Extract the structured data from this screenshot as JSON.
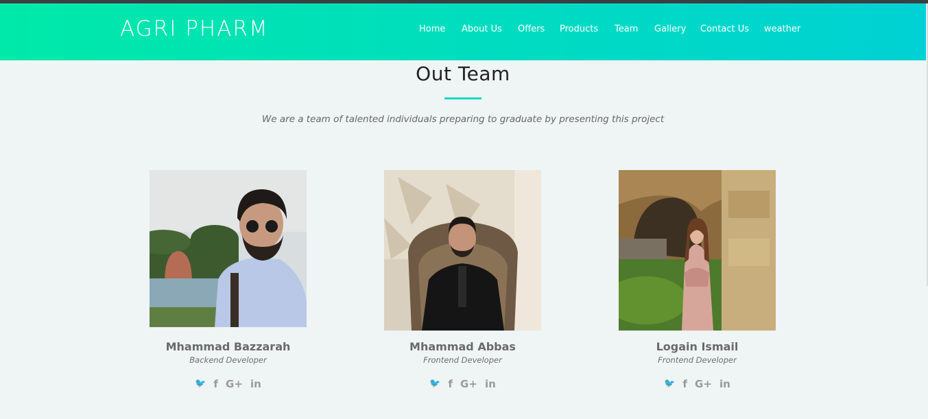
{
  "brand": "AGRI PHARM",
  "nav": [
    "Home",
    "About Us",
    "Offers",
    "Products",
    "Team",
    "Gallery",
    "Contact Us",
    "weather"
  ],
  "section": {
    "title": "Out Team",
    "subtitle": "We are a team of talented individuals preparing to graduate by presenting this project"
  },
  "members": [
    {
      "name": "Mhammad Bazzarah",
      "role": "Backend Developer"
    },
    {
      "name": "Mhammad Abbas",
      "role": "Frontend Developer"
    },
    {
      "name": "Logain Ismail",
      "role": "Frontend Developer"
    }
  ],
  "social_icons": [
    "twitter-icon",
    "facebook-icon",
    "google-plus-icon",
    "linkedin-icon"
  ],
  "social_glyphs": {
    "twitter": "🐦",
    "facebook": "f",
    "google_plus": "G+",
    "linkedin": "in"
  },
  "colors": {
    "accent": "#18d8c4",
    "nav_gradient_start": "#00e9a8",
    "nav_gradient_end": "#00d1d4",
    "background": "#eff4f4"
  }
}
